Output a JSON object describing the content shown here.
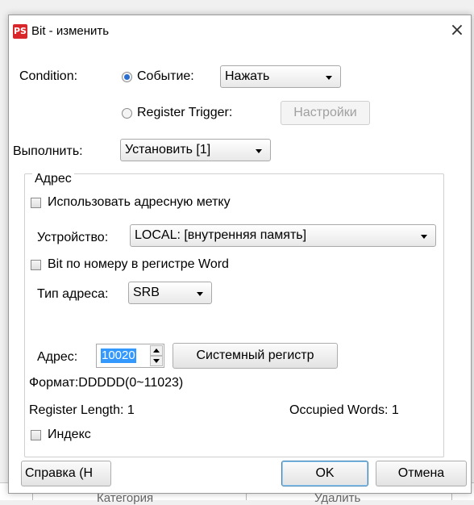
{
  "dialog": {
    "title": "Bit - изменить",
    "app_icon_text": "PS",
    "close_glyph": "×"
  },
  "condition": {
    "label": "Condition:",
    "event_option": "Событие:",
    "event_value": "Нажать",
    "register_option": "Register Trigger:",
    "settings_button": "Настройки"
  },
  "execute": {
    "label": "Выполнить:",
    "value": "Установить [1]"
  },
  "address_group": {
    "title": "Адрес",
    "use_tag_label": "Использовать адресную метку",
    "device_label": "Устройство:",
    "device_value": "LOCAL: [внутренняя память]",
    "bit_by_word_label": "Bit по номеру в регистре Word",
    "address_type_label": "Тип адреса:",
    "address_type_value": "SRB",
    "address_label": "Адрес:",
    "address_value": "10020",
    "system_register_button": "Системный регистр",
    "format_text": "Формат:DDDDD(0~11023)",
    "register_length": "Register Length: 1",
    "occupied_words": "Occupied Words: 1",
    "index_label": "Индекс"
  },
  "footer": {
    "help_button": "Справка (H",
    "ok_button": "OK",
    "cancel_button": "Отмена"
  },
  "background": {
    "col1_text": "Категория",
    "col2_text": "Удалить"
  },
  "colors": {
    "accent": "#2a6fd0",
    "selection": "#3399ff",
    "icon_red": "#d9262b"
  }
}
